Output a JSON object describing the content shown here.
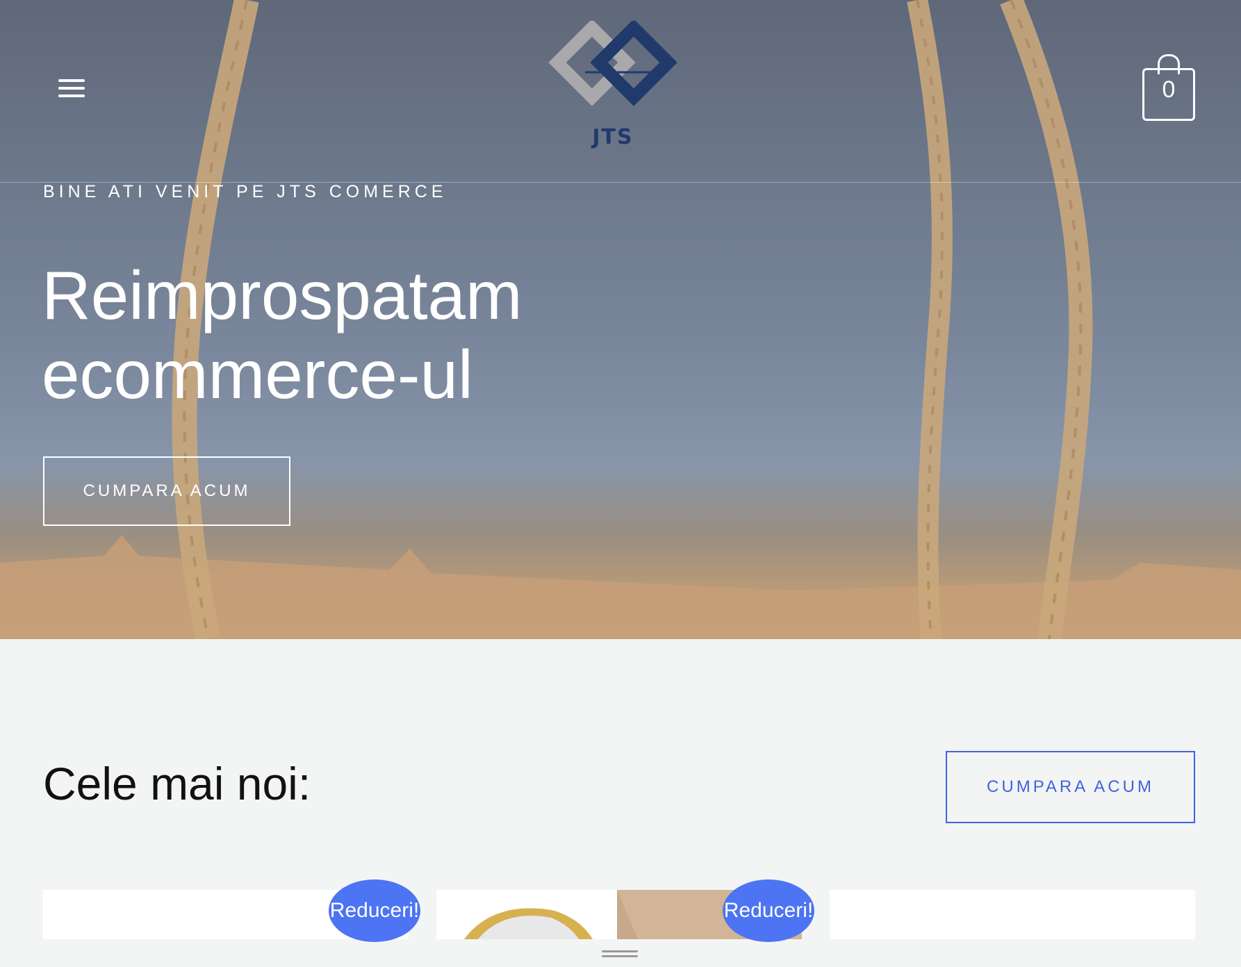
{
  "header": {
    "logo_text": "JTS",
    "cart_count": "0"
  },
  "hero": {
    "eyebrow": "BINE ATI VENIT PE JTS COMERCE",
    "headline_line1": "Reimprospatam",
    "headline_line2": "ecommerce-ul",
    "cta_label": "CUMPARA ACUM"
  },
  "latest": {
    "title": "Cele mai noi:",
    "cta_label": "CUMPARA ACUM",
    "products": [
      {
        "badge": "Reduceri!"
      },
      {
        "badge": "Reduceri!"
      },
      {
        "badge": ""
      }
    ]
  },
  "colors": {
    "accent": "#3f63df",
    "badge": "#4c74f3",
    "logo_blue": "#1f3a6b",
    "logo_gray": "#a9a9ab"
  },
  "icons": [
    "hamburger-menu-icon",
    "shopping-bag-icon",
    "drag-handle-icon"
  ]
}
